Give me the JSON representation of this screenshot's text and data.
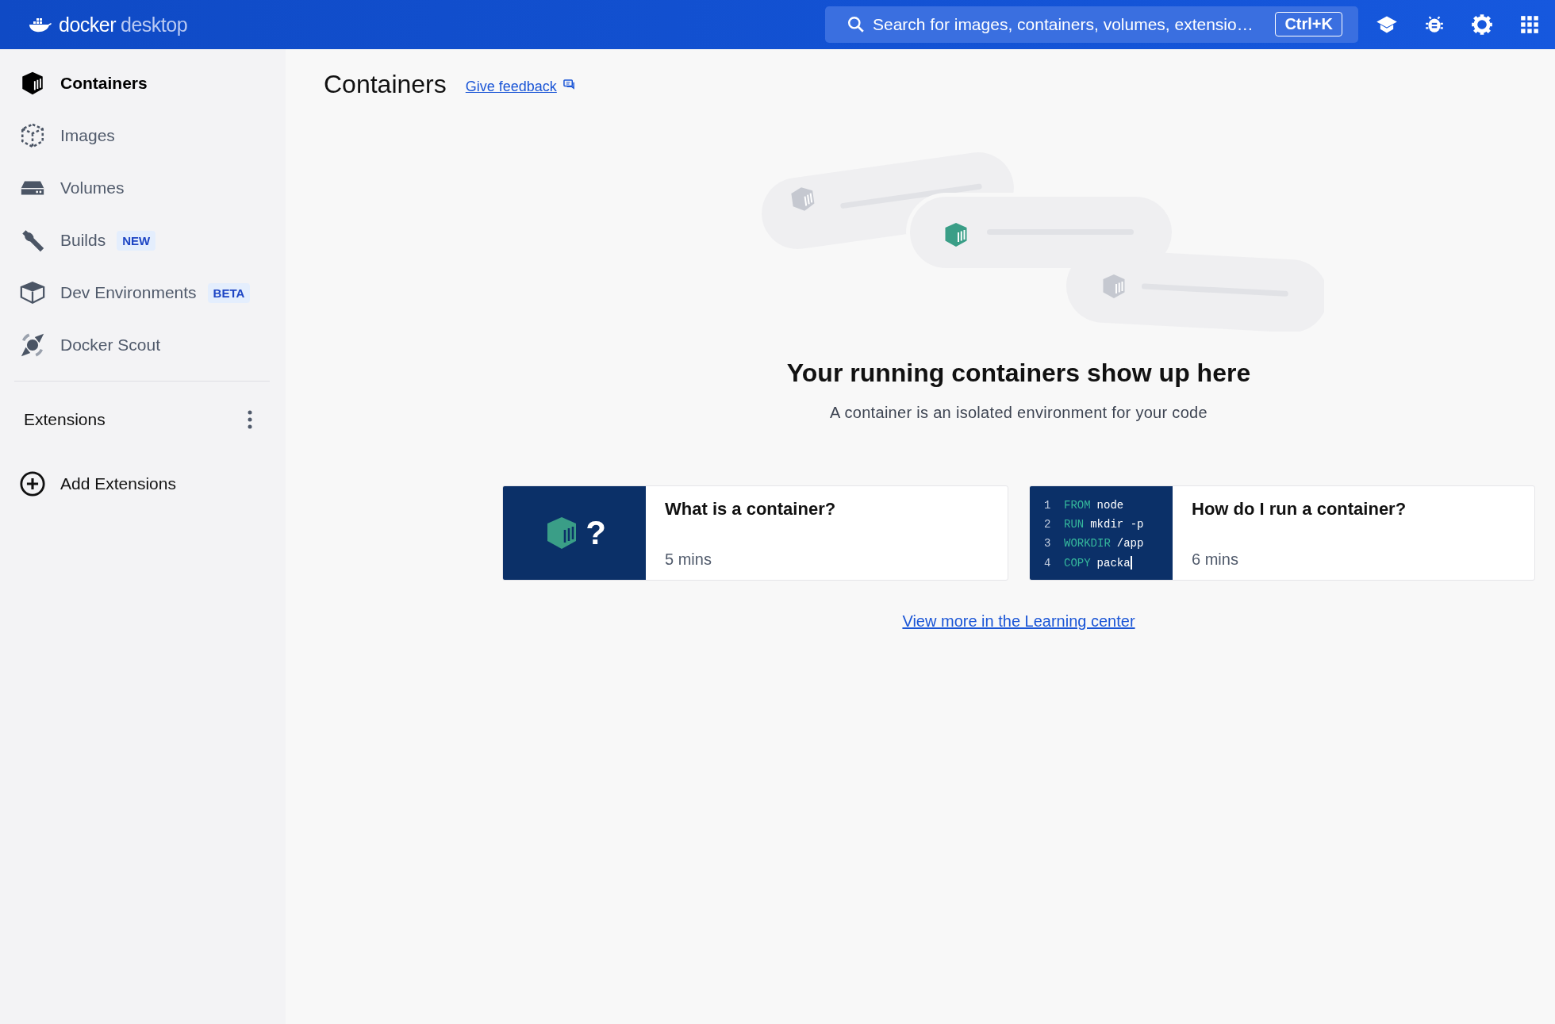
{
  "header": {
    "logo_word": "docker",
    "logo_product": "desktop",
    "search": {
      "placeholder": "Search for images, containers, volumes, extensio…",
      "shortcut": "Ctrl+K"
    },
    "actions": [
      {
        "kind": "learn"
      },
      {
        "kind": "bug"
      },
      {
        "kind": "settings"
      },
      {
        "kind": "apps"
      }
    ]
  },
  "sidebar": {
    "items": [
      {
        "label": "Containers",
        "kind": "containers",
        "selected": true
      },
      {
        "label": "Images",
        "kind": "images",
        "selected": false
      },
      {
        "label": "Volumes",
        "kind": "volumes",
        "selected": false
      },
      {
        "label": "Builds",
        "kind": "builds",
        "selected": false,
        "badge": "NEW"
      },
      {
        "label": "Dev Environments",
        "kind": "devenv",
        "selected": false,
        "badge": "BETA"
      },
      {
        "label": "Docker Scout",
        "kind": "scout",
        "selected": false
      }
    ],
    "extensions_title": "Extensions",
    "add_extensions": "Add Extensions"
  },
  "page": {
    "title": "Containers",
    "feedback": "Give feedback"
  },
  "empty_state": {
    "heading": "Your running containers show up here",
    "text": "A container is an isolated environment for your code"
  },
  "cards": [
    {
      "kind": "icon",
      "glyph": "?",
      "title": "What is a container?",
      "duration": "5 mins"
    },
    {
      "kind": "code",
      "title": "How do I run a container?",
      "duration": "6 mins",
      "code": [
        {
          "num": "1",
          "keyword": "FROM",
          "rest": "node"
        },
        {
          "num": "2",
          "keyword": "RUN",
          "rest": "mkdir -p"
        },
        {
          "num": "3",
          "keyword": "WORKDIR",
          "rest": "/app"
        },
        {
          "num": "4",
          "keyword": "COPY",
          "rest": "packa"
        }
      ]
    }
  ],
  "learning_link": "View more in the Learning center"
}
